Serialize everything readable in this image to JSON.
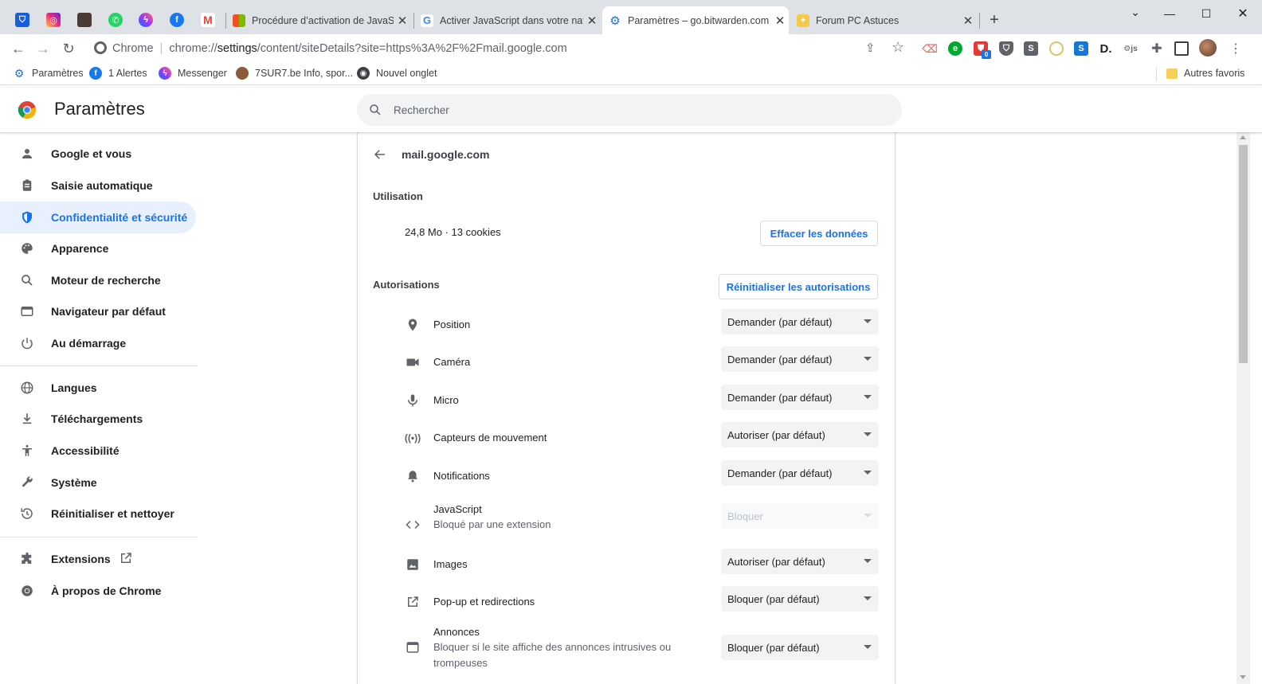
{
  "tabs": {
    "pinned_icons": [
      "bitwarden-icon",
      "instagram-icon",
      "app-icon",
      "whatsapp-icon",
      "messenger-icon",
      "facebook-icon",
      "gmail-icon"
    ],
    "items": [
      {
        "title": "Procédure d’activation de JavaSc",
        "favicon": "windows-icon",
        "active": false
      },
      {
        "title": "Activer JavaScript dans votre nav",
        "favicon": "google-icon",
        "active": false
      },
      {
        "title": "Paramètres – go.bitwarden.com",
        "favicon": "gear-icon",
        "active": true
      },
      {
        "title": "Forum PC Astuces",
        "favicon": "forum-icon",
        "active": false
      }
    ],
    "new_tab_label": "+"
  },
  "toolbar": {
    "chrome_label": "Chrome",
    "url_prefix": "chrome://",
    "url_host": "settings",
    "url_path": "/content/siteDetails?site=https%3A%2F%2Fmail.google.com"
  },
  "bookmarks": {
    "items": [
      {
        "label": "Paramètres",
        "icon": "gear-icon"
      },
      {
        "label": "1 Alertes",
        "icon": "facebook-icon"
      },
      {
        "label": "Messenger",
        "icon": "messenger-icon"
      },
      {
        "label": "7SUR7.be Info, spor...",
        "icon": "cookie-icon"
      },
      {
        "label": "Nouvel onglet",
        "icon": "chrome-icon"
      }
    ],
    "other_label": "Autres favoris"
  },
  "header": {
    "title": "Paramètres",
    "search_placeholder": "Rechercher"
  },
  "sidebar": {
    "items": [
      {
        "label": "Google et vous",
        "icon": "person-icon"
      },
      {
        "label": "Saisie automatique",
        "icon": "clipboard-icon"
      },
      {
        "label": "Confidentialité et sécurité",
        "icon": "shield-icon",
        "active": true
      },
      {
        "label": "Apparence",
        "icon": "palette-icon"
      },
      {
        "label": "Moteur de recherche",
        "icon": "search-icon"
      },
      {
        "label": "Navigateur par défaut",
        "icon": "browser-icon"
      },
      {
        "label": "Au démarrage",
        "icon": "power-icon"
      },
      {
        "label": "Langues",
        "icon": "globe-icon"
      },
      {
        "label": "Téléchargements",
        "icon": "download-icon"
      },
      {
        "label": "Accessibilité",
        "icon": "accessibility-icon"
      },
      {
        "label": "Système",
        "icon": "wrench-icon"
      },
      {
        "label": "Réinitialiser et nettoyer",
        "icon": "history-icon"
      },
      {
        "label": "Extensions",
        "icon": "puzzle-icon"
      },
      {
        "label": "À propos de Chrome",
        "icon": "chrome-icon"
      }
    ]
  },
  "site": {
    "host": "mail.google.com",
    "usage_heading": "Utilisation",
    "usage_value": "24,8 Mo · 13 cookies",
    "clear_button": "Effacer les données",
    "permissions_heading": "Autorisations",
    "reset_button": "Réinitialiser les autorisations",
    "permissions": [
      {
        "label": "Position",
        "value": "Demander (par défaut)",
        "icon": "location-pin-icon"
      },
      {
        "label": "Caméra",
        "value": "Demander (par défaut)",
        "icon": "camera-icon"
      },
      {
        "label": "Micro",
        "value": "Demander (par défaut)",
        "icon": "microphone-icon"
      },
      {
        "label": "Capteurs de mouvement",
        "value": "Autoriser (par défaut)",
        "icon": "sensors-icon"
      },
      {
        "label": "Notifications",
        "value": "Demander (par défaut)",
        "icon": "bell-icon"
      },
      {
        "label": "JavaScript",
        "sublabel": "Bloqué par une extension",
        "value": "Bloquer",
        "icon": "code-icon",
        "disabled": true
      },
      {
        "label": "Images",
        "value": "Autoriser (par défaut)",
        "icon": "image-icon"
      },
      {
        "label": "Pop-up et redirections",
        "value": "Bloquer (par défaut)",
        "icon": "open-external-icon"
      },
      {
        "label": "Annonces",
        "sublabel": "Bloquer si le site affiche des annonces intrusives ou trompeuses",
        "value": "Bloquer (par défaut)",
        "icon": "ads-icon"
      }
    ]
  },
  "colors": {
    "accent": "#1a73e8",
    "active_nav_bg": "#e8f0fe",
    "tabstrip_bg": "#dee1e6"
  }
}
